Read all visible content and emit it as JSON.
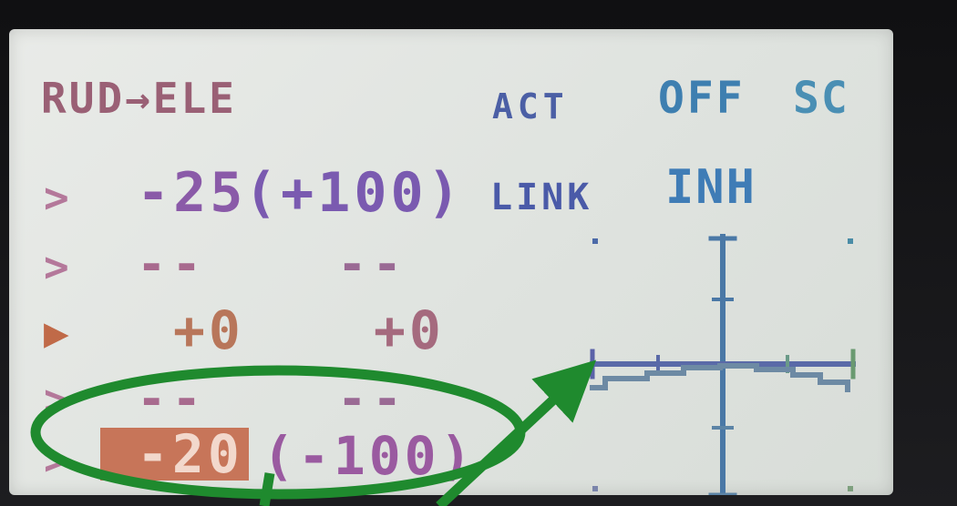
{
  "screen": {
    "title": "RUD→ELE",
    "act_label": "ACT",
    "mode_label": "OFF",
    "sc_label": "SC",
    "link_label": "LINK",
    "inh_label": "INH"
  },
  "rows": [
    {
      "marker": ">",
      "value": "-25",
      "paren": "(+100)"
    },
    {
      "marker": ">",
      "value": "--",
      "paren": "--"
    },
    {
      "marker": "▶",
      "value": "+0",
      "paren": "+0"
    },
    {
      "marker": ">",
      "value": "--",
      "paren": "--"
    },
    {
      "marker": ">",
      "value": "-20",
      "paren": "(-100)"
    }
  ],
  "colors": {
    "lcd_bg": "#e3e6e2",
    "highlight": "#c77559",
    "annotation": "#1f8a2e"
  },
  "graph": {
    "axes": "crosshair",
    "curve": "mixing curve"
  }
}
